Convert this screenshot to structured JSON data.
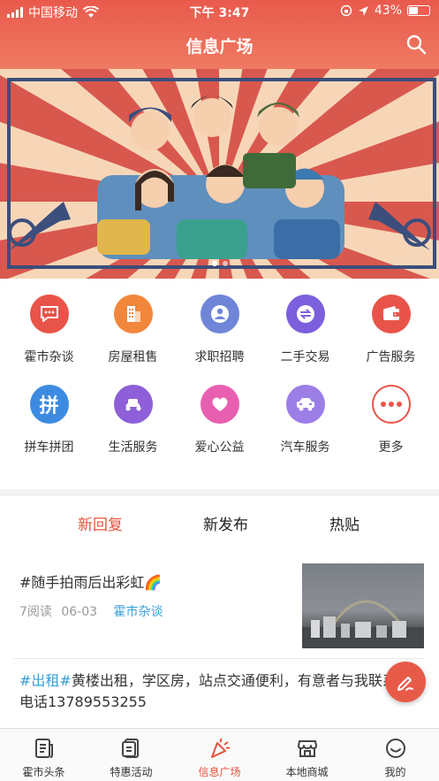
{
  "status_bar": {
    "carrier": "中国移动",
    "time": "下午 3:47",
    "battery": "43%"
  },
  "header": {
    "title": "信息广场"
  },
  "services": [
    {
      "label": "霍市杂谈",
      "icon": "chat-icon",
      "color": "#e9544a"
    },
    {
      "label": "房屋租售",
      "icon": "building-icon",
      "color": "#f2873c"
    },
    {
      "label": "求职招聘",
      "icon": "person-icon",
      "color": "#6f86d8"
    },
    {
      "label": "二手交易",
      "icon": "exchange-icon",
      "color": "#7b5fdc"
    },
    {
      "label": "广告服务",
      "icon": "wallet-icon",
      "color": "#e9544a"
    },
    {
      "label": "拼车拼团",
      "icon": "pin-icon",
      "color": "#3d8be0",
      "glyph": "拼"
    },
    {
      "label": "生活服务",
      "icon": "scooter-icon",
      "color": "#8e5fd8"
    },
    {
      "label": "爱心公益",
      "icon": "heart-icon",
      "color": "#e85fb0"
    },
    {
      "label": "汽车服务",
      "icon": "car-icon",
      "color": "#9b7ee6"
    },
    {
      "label": "更多",
      "icon": "more-icon",
      "color": "#e9544a"
    }
  ],
  "tabs": [
    {
      "label": "新回复",
      "active": true
    },
    {
      "label": "新发布",
      "active": false
    },
    {
      "label": "热贴",
      "active": false
    }
  ],
  "posts": [
    {
      "title": "#随手拍雨后出彩虹🌈",
      "reads": "7阅读",
      "date": "06-03",
      "category": "霍市杂谈"
    },
    {
      "tag": "#出租#",
      "text": "黄楼出租，学区房，站点交通便利，有意者与我联系",
      "phone_line": "电话13789553255"
    }
  ],
  "bottom_nav": [
    {
      "label": "霍市头条",
      "icon": "news-icon",
      "active": false
    },
    {
      "label": "特惠活动",
      "icon": "coupon-icon",
      "active": false
    },
    {
      "label": "信息广场",
      "icon": "party-icon",
      "active": true
    },
    {
      "label": "本地商城",
      "icon": "store-icon",
      "active": false
    },
    {
      "label": "我的",
      "icon": "smile-icon",
      "active": false
    }
  ]
}
